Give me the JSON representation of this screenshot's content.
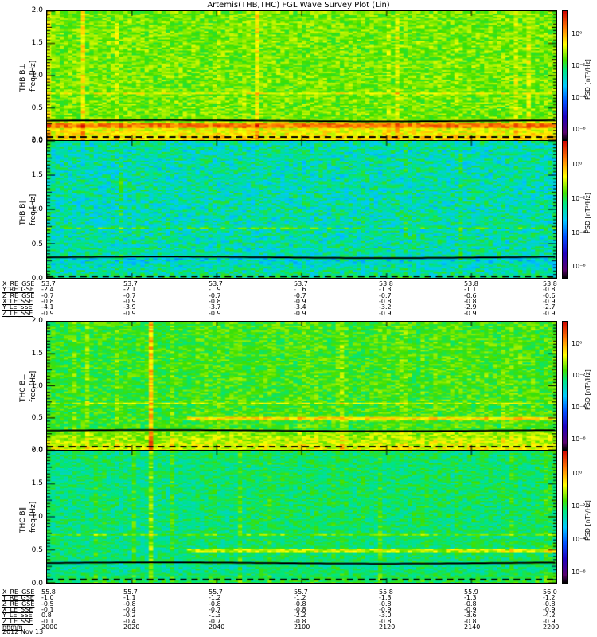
{
  "chart_data": {
    "type": "heatmap",
    "title": "Artemis(THB,THC) FGL Wave Survey Plot (Lin)",
    "x_range_hhmm": [
      "2000",
      "2200"
    ],
    "date": "2012 Nov 13",
    "y_ticks": [
      "0.0",
      "0.5",
      "1.0",
      "1.5",
      "2.0"
    ],
    "ylim": [
      0,
      2.0
    ],
    "ylabel": "freq [Hz]",
    "colorbar": {
      "label": "PSD [nT²/Hz]",
      "ticks": [
        "10⁰",
        "10⁻²",
        "10⁻⁴",
        "10⁻⁶"
      ],
      "range_log10": [
        -7,
        1
      ]
    },
    "panels": [
      {
        "name": "THB B⊥",
        "base_log10": -1.8,
        "line_hz": 0.3,
        "dashed_hz": 0.05
      },
      {
        "name": "THB B∥",
        "base_log10": -3.0,
        "line_hz": 0.3,
        "dashed_hz": 0.02
      },
      {
        "name": "THC B⊥",
        "base_log10": -2.2,
        "line_hz": 0.3,
        "dashed_hz": 0.05
      },
      {
        "name": "THC B∥",
        "base_log10": -2.7,
        "line_hz": 0.3,
        "dashed_hz": 0.05
      }
    ],
    "ephemeris": [
      {
        "labels": [
          "X_RE_GSE",
          "Y_RE_GSE",
          "Z_RE_GSE",
          "X_LE_SSE",
          "Y_LE_SSE",
          "Z_LE_SSE"
        ],
        "rows": [
          [
            "53.7",
            "53.7",
            "53.7",
            "53.7",
            "53.8",
            "53.8",
            "53.8"
          ],
          [
            "-2.4",
            "-2.1",
            "-1.9",
            "-1.6",
            "-1.3",
            "-1.1",
            "-0.8"
          ],
          [
            "-0.7",
            "-0.7",
            "-0.7",
            "-0.7",
            "-0.7",
            "-0.6",
            "-0.6"
          ],
          [
            "-0.8",
            "-0.9",
            "-0.8",
            "-0.9",
            "-0.8",
            "-0.8",
            "-0.9"
          ],
          [
            "-4.1",
            "-3.9",
            "-3.7",
            "-3.4",
            "-3.2",
            "-2.9",
            "-2.7"
          ],
          [
            "-0.9",
            "-0.9",
            "-0.9",
            "-0.9",
            "-0.9",
            "-0.9",
            "-0.9"
          ]
        ]
      },
      {
        "labels": [
          "X_RE_GSE",
          "Y_RE_GSE",
          "Z_RE_GSE",
          "X_LE_SSE",
          "Y_LE_SSE",
          "Z_LE_SSE",
          "hhmm"
        ],
        "rows": [
          [
            "55.8",
            "55.7",
            "55.7",
            "55.7",
            "55.8",
            "55.9",
            "56.0"
          ],
          [
            "-1.0",
            "-1.1",
            "-1.2",
            "-1.2",
            "-1.3",
            "-1.3",
            "-1.2"
          ],
          [
            "-0.5",
            "-0.8",
            "-0.8",
            "-0.8",
            "-0.8",
            "-0.8",
            "-0.8"
          ],
          [
            "-0.1",
            "-0.4",
            "-0.7",
            "-0.8",
            "-0.9",
            "-0.9",
            "-0.9"
          ],
          [
            "0.8",
            "-0.2",
            "-1.3",
            "-2.2",
            "-3.0",
            "-3.6",
            "-4.2"
          ],
          [
            "-0.1",
            "-0.4",
            "-0.7",
            "-0.8",
            "-0.8",
            "-0.8",
            "-0.9"
          ],
          [
            "2000",
            "2020",
            "2040",
            "2100",
            "2120",
            "2140",
            "2200"
          ]
        ]
      }
    ]
  }
}
